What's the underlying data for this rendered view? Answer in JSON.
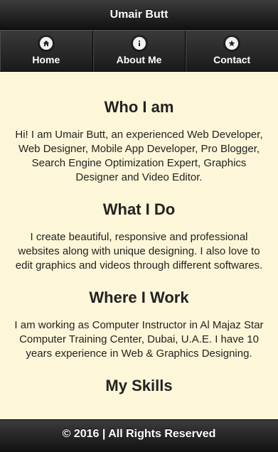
{
  "header": {
    "title": "Umair Butt"
  },
  "nav": {
    "items": [
      {
        "label": "Home",
        "icon": "home-icon"
      },
      {
        "label": "About Me",
        "icon": "info-icon"
      },
      {
        "label": "Contact",
        "icon": "star-icon"
      }
    ]
  },
  "sections": [
    {
      "heading": "Who I am",
      "text": "Hi! I am Umair Butt, an experienced Web Developer, Web Designer, Mobile App Developer, Pro Blogger, Search Engine Optimization Expert, Graphics Designer and Video Editor."
    },
    {
      "heading": "What I Do",
      "text": "I create beautiful, responsive and professional websites along with unique designing. I also love to edit graphics and videos through different softwares."
    },
    {
      "heading": "Where I Work",
      "text": "I am working as Computer Instructor in Al Majaz Star Computer Training Center, Dubai, U.A.E. I have 10 years experience in Web & Graphics Designing."
    },
    {
      "heading": "My Skills"
    }
  ],
  "footer": {
    "text": "© 2016 | All Rights Reserved"
  },
  "colors": {
    "page_background": "#fef6d8",
    "bar_background": "#1a1a1a",
    "bar_text": "#ffffff",
    "body_text": "#222222"
  }
}
